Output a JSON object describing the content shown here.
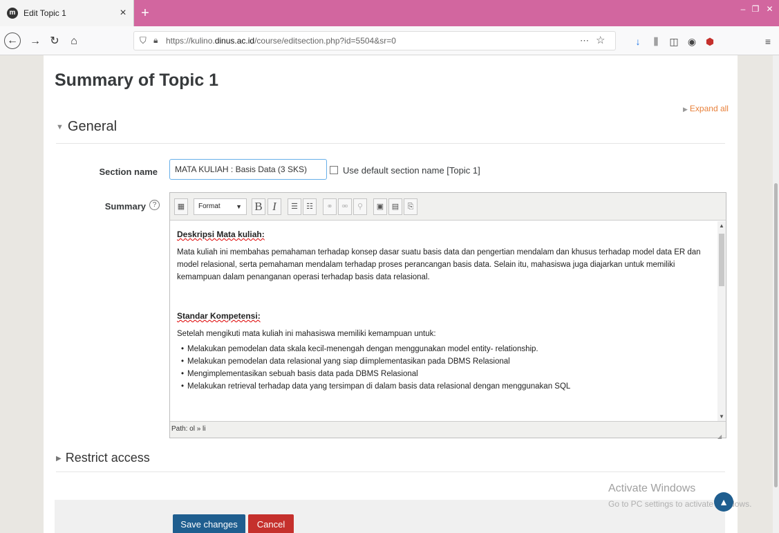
{
  "browser": {
    "tab_title": "Edit Topic 1",
    "tab_favicon": "m",
    "url_prefix": "https://kulino.",
    "url_domain": "dinus.ac.id",
    "url_path": "/course/editsection.php?id=5504&sr=0",
    "colors": {
      "tabbar": "#d2669f"
    }
  },
  "page": {
    "title": "Summary of Topic 1",
    "expand_all": "Expand all",
    "general_header": "General",
    "section_name_label": "Section name",
    "section_name_value": "MATA KULIAH : Basis Data (3 SKS)",
    "use_default_label": "Use default section name [Topic 1]",
    "summary_label": "Summary",
    "restrict_header": "Restrict access",
    "save_label": "Save changes",
    "cancel_label": "Cancel"
  },
  "editor": {
    "format_label": "Format",
    "path": "Path: ol » li",
    "heading1": "Deskripsi Mata kuliah:",
    "para1": "Mata kuliah ini membahas pemahaman terhadap konsep dasar suatu basis data dan pengertian mendalam dan khusus terhadap model data ER dan model relasional, serta pemahaman mendalam terhadap proses perancangan basis data. Selain itu, mahasiswa juga diajarkan untuk memiliki kemampuan dalam penanganan operasi terhadap basis data relasional.",
    "heading2": "Standar Kompetensi:",
    "para2": "Setelah mengikuti mata kuliah ini mahasiswa memiliki kemampuan untuk:",
    "bullets": [
      "Melakukan pemodelan data skala kecil-menengah dengan menggunakan model entity- relationship.",
      "Melakukan pemodelan data relasional yang siap diimplementasikan pada DBMS Relasional",
      "Mengimplementasikan sebuah basis data pada DBMS Relasional",
      "Melakukan retrieval terhadap data yang tersimpan di dalam basis data relasional dengan menggunakan SQL"
    ]
  },
  "overlay": {
    "activate_title": "Activate Windows",
    "activate_sub": "Go to PC settings to activate Windows."
  }
}
